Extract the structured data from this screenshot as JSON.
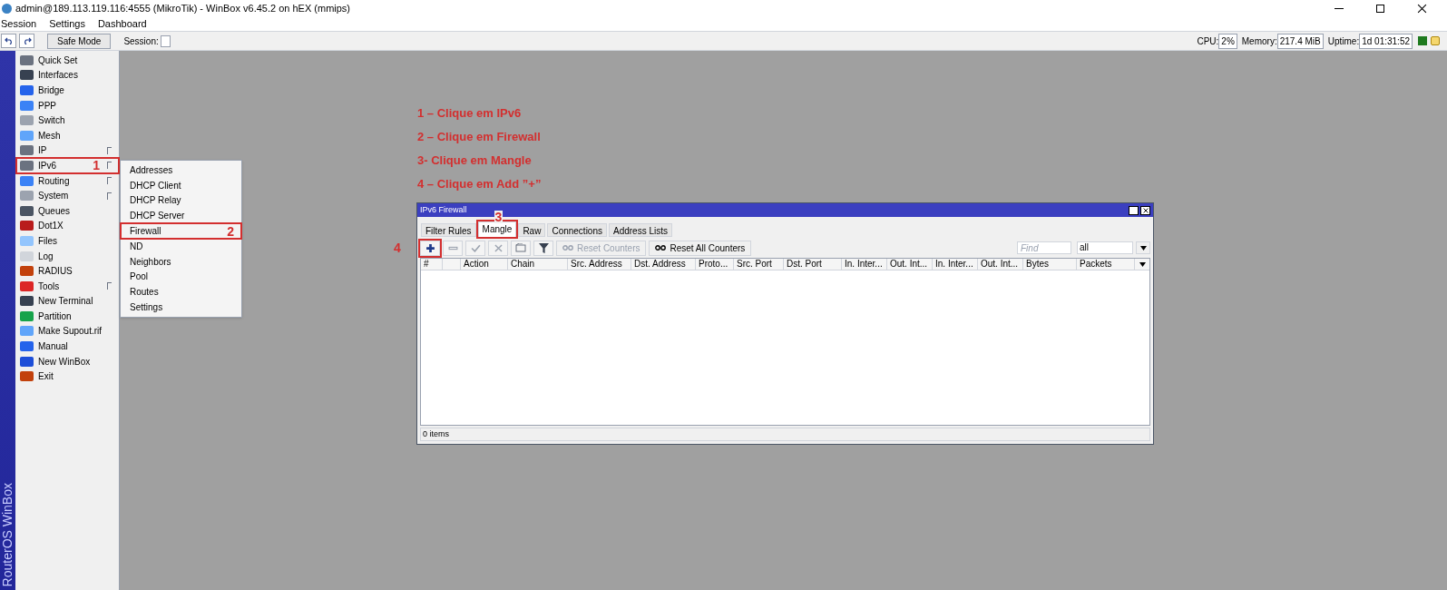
{
  "window": {
    "title": "admin@189.113.119.116:4555 (MikroTik) - WinBox v6.45.2 on hEX (mmips)"
  },
  "menu_bar": [
    "Session",
    "Settings",
    "Dashboard"
  ],
  "toolbar": {
    "safe_mode": "Safe Mode",
    "session_label": "Session:",
    "cpu_label": "CPU:",
    "cpu": "2%",
    "memory_label": "Memory:",
    "memory": "217.4 MiB",
    "uptime_label": "Uptime:",
    "uptime": "1d 01:31:52"
  },
  "side_menu": {
    "brand": "RouterOS WinBox",
    "items": [
      {
        "label": "Quick Set",
        "has_submenu": false
      },
      {
        "label": "Interfaces",
        "has_submenu": false
      },
      {
        "label": "Bridge",
        "has_submenu": false
      },
      {
        "label": "PPP",
        "has_submenu": false
      },
      {
        "label": "Switch",
        "has_submenu": false
      },
      {
        "label": "Mesh",
        "has_submenu": false
      },
      {
        "label": "IP",
        "has_submenu": true
      },
      {
        "label": "IPv6",
        "has_submenu": true,
        "marker": "1"
      },
      {
        "label": "Routing",
        "has_submenu": true
      },
      {
        "label": "System",
        "has_submenu": true
      },
      {
        "label": "Queues",
        "has_submenu": false
      },
      {
        "label": "Dot1X",
        "has_submenu": false
      },
      {
        "label": "Files",
        "has_submenu": false
      },
      {
        "label": "Log",
        "has_submenu": false
      },
      {
        "label": "RADIUS",
        "has_submenu": false
      },
      {
        "label": "Tools",
        "has_submenu": true
      },
      {
        "label": "New Terminal",
        "has_submenu": false
      },
      {
        "label": "Partition",
        "has_submenu": false
      },
      {
        "label": "Make Supout.rif",
        "has_submenu": false
      },
      {
        "label": "Manual",
        "has_submenu": false
      },
      {
        "label": "New WinBox",
        "has_submenu": false
      },
      {
        "label": "Exit",
        "has_submenu": false
      }
    ]
  },
  "submenu": [
    {
      "label": "Addresses"
    },
    {
      "label": "DHCP Client"
    },
    {
      "label": "DHCP Relay"
    },
    {
      "label": "DHCP Server"
    },
    {
      "label": "Firewall",
      "marker": "2"
    },
    {
      "label": "ND"
    },
    {
      "label": "Neighbors"
    },
    {
      "label": "Pool"
    },
    {
      "label": "Routes"
    },
    {
      "label": "Settings"
    }
  ],
  "instructions": [
    "1 – Clique em IPv6",
    "2 – Clique em Firewall",
    "3- Clique em Mangle",
    "4 – Clique em Add ”+”"
  ],
  "firewall_window": {
    "title": "IPv6 Firewall",
    "tabs": [
      {
        "label": "Filter Rules",
        "selected": false
      },
      {
        "label": "Mangle",
        "selected": true,
        "marker": "3"
      },
      {
        "label": "Raw",
        "selected": false
      },
      {
        "label": "Connections",
        "selected": false
      },
      {
        "label": "Address Lists",
        "selected": false
      }
    ],
    "add_marker": "4",
    "reset_counters": {
      "label": "Reset Counters",
      "disabled": true
    },
    "reset_all_counters": {
      "label": "Reset All Counters",
      "disabled": false
    },
    "find": {
      "placeholder": "Find"
    },
    "filter": {
      "value": "all"
    },
    "columns": [
      "#",
      "Action",
      "Chain",
      "Src. Address",
      "Dst. Address",
      "Proto...",
      "Src. Port",
      "Dst. Port",
      "In. Inter...",
      "Out. Int...",
      "In. Inter...",
      "Out. Int...",
      "Bytes",
      "Packets"
    ],
    "status": "0 items"
  }
}
